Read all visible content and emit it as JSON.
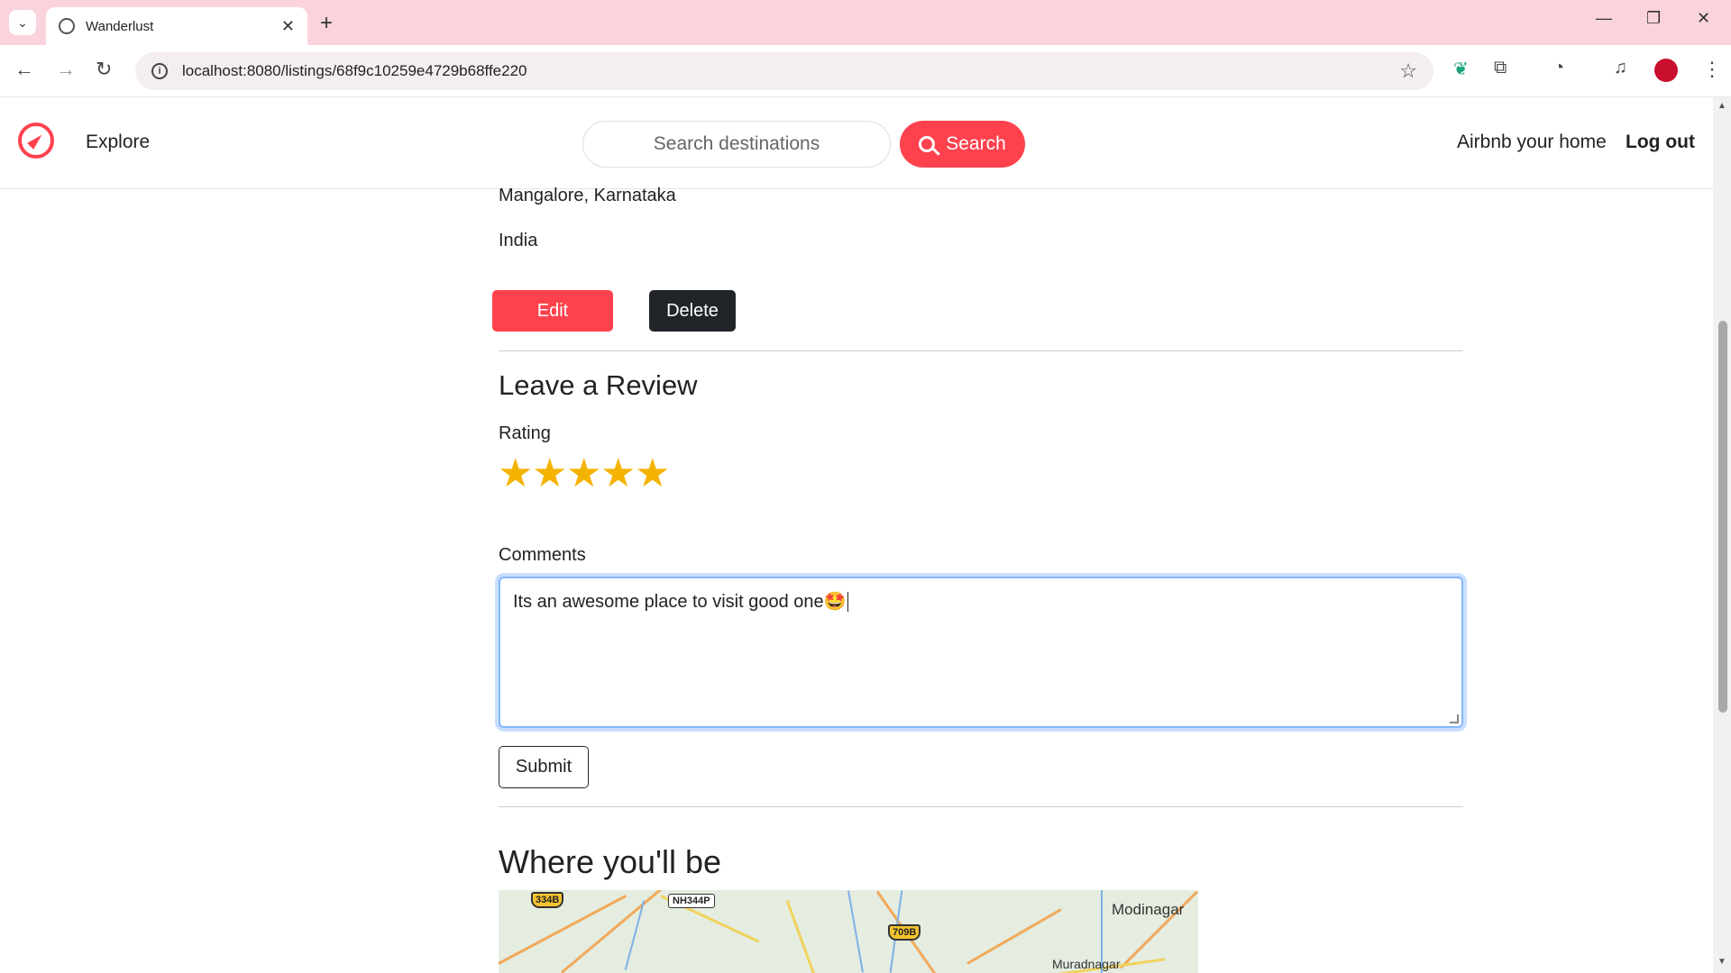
{
  "browser": {
    "tab_title": "Wanderlust",
    "url": "localhost:8080/listings/68f9c10259e4729b68ffe220",
    "new_tab_symbol": "+",
    "tab_close_symbol": "✕"
  },
  "header": {
    "explore": "Explore",
    "search_placeholder": "Search destinations",
    "search_button": "Search",
    "airbnb_home": "Airbnb your home",
    "logout": "Log out",
    "accent_color": "#fe424d"
  },
  "listing": {
    "location": "Mangalore, Karnataka",
    "country": "India",
    "edit_label": "Edit",
    "delete_label": "Delete"
  },
  "review": {
    "heading": "Leave a Review",
    "rating_label": "Rating",
    "rating_value": 5,
    "rating_max": 5,
    "comments_label": "Comments",
    "comment_text": "Its an awesome place to visit good one🤩",
    "submit_label": "Submit"
  },
  "map_section": {
    "heading": "Where you'll be",
    "labels": {
      "town1": "Modinagar",
      "town2": "Muradnagar",
      "shield1": "334B",
      "shield2": "709B",
      "nh": "NH344P"
    }
  }
}
